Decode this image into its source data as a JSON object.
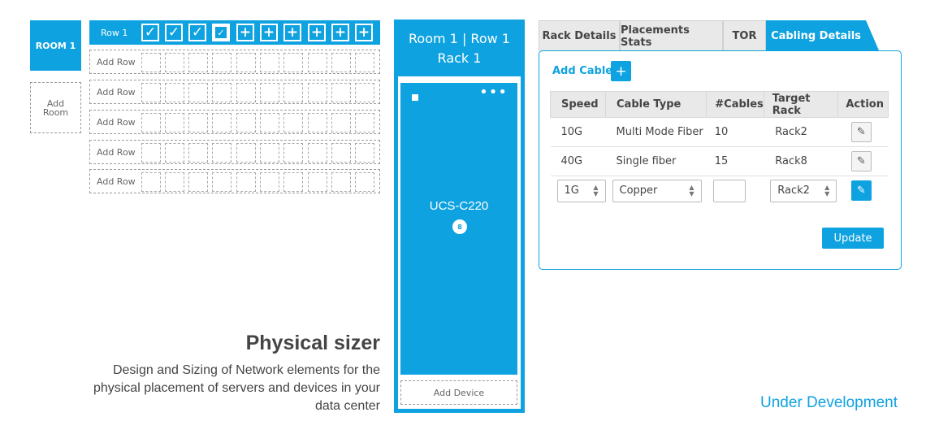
{
  "rooms": {
    "room1": "ROOM 1",
    "add_room": "Add Room"
  },
  "rows": {
    "active_label": "Row 1",
    "add_label": "Add Row",
    "active_slots": [
      "check",
      "check",
      "check",
      "checkbox",
      "plus",
      "plus",
      "plus",
      "plus",
      "plus",
      "plus"
    ]
  },
  "rack": {
    "title_line1": "Room 1 | Row 1",
    "title_line2": "Rack 1",
    "device_name": "UCS-C220",
    "device_count": "8",
    "add_device": "Add Device"
  },
  "tabs": [
    "Rack Details",
    "Placements Stats",
    "TOR",
    "Cabling Details"
  ],
  "cabling": {
    "add_cable": "Add Cable",
    "columns": [
      "Speed",
      "Cable Type",
      "#Cables",
      "Target Rack",
      "Action"
    ],
    "rows": [
      {
        "speed": "10G",
        "cable_type": "Multi Mode Fiber",
        "cables": "10",
        "target_rack": "Rack2"
      },
      {
        "speed": "40G",
        "cable_type": "Single fiber",
        "cables": "15",
        "target_rack": "Rack8"
      }
    ],
    "edit_row": {
      "speed": "1G",
      "cable_type": "Copper",
      "cables": "",
      "target_rack": "Rack2"
    },
    "update": "Update"
  },
  "footer": {
    "headline": "Physical sizer",
    "description": "Design and Sizing of Network elements for the physical placement of servers and devices in your data center",
    "status": "Under Development"
  },
  "colors": {
    "accent": "#0ea2e0"
  }
}
